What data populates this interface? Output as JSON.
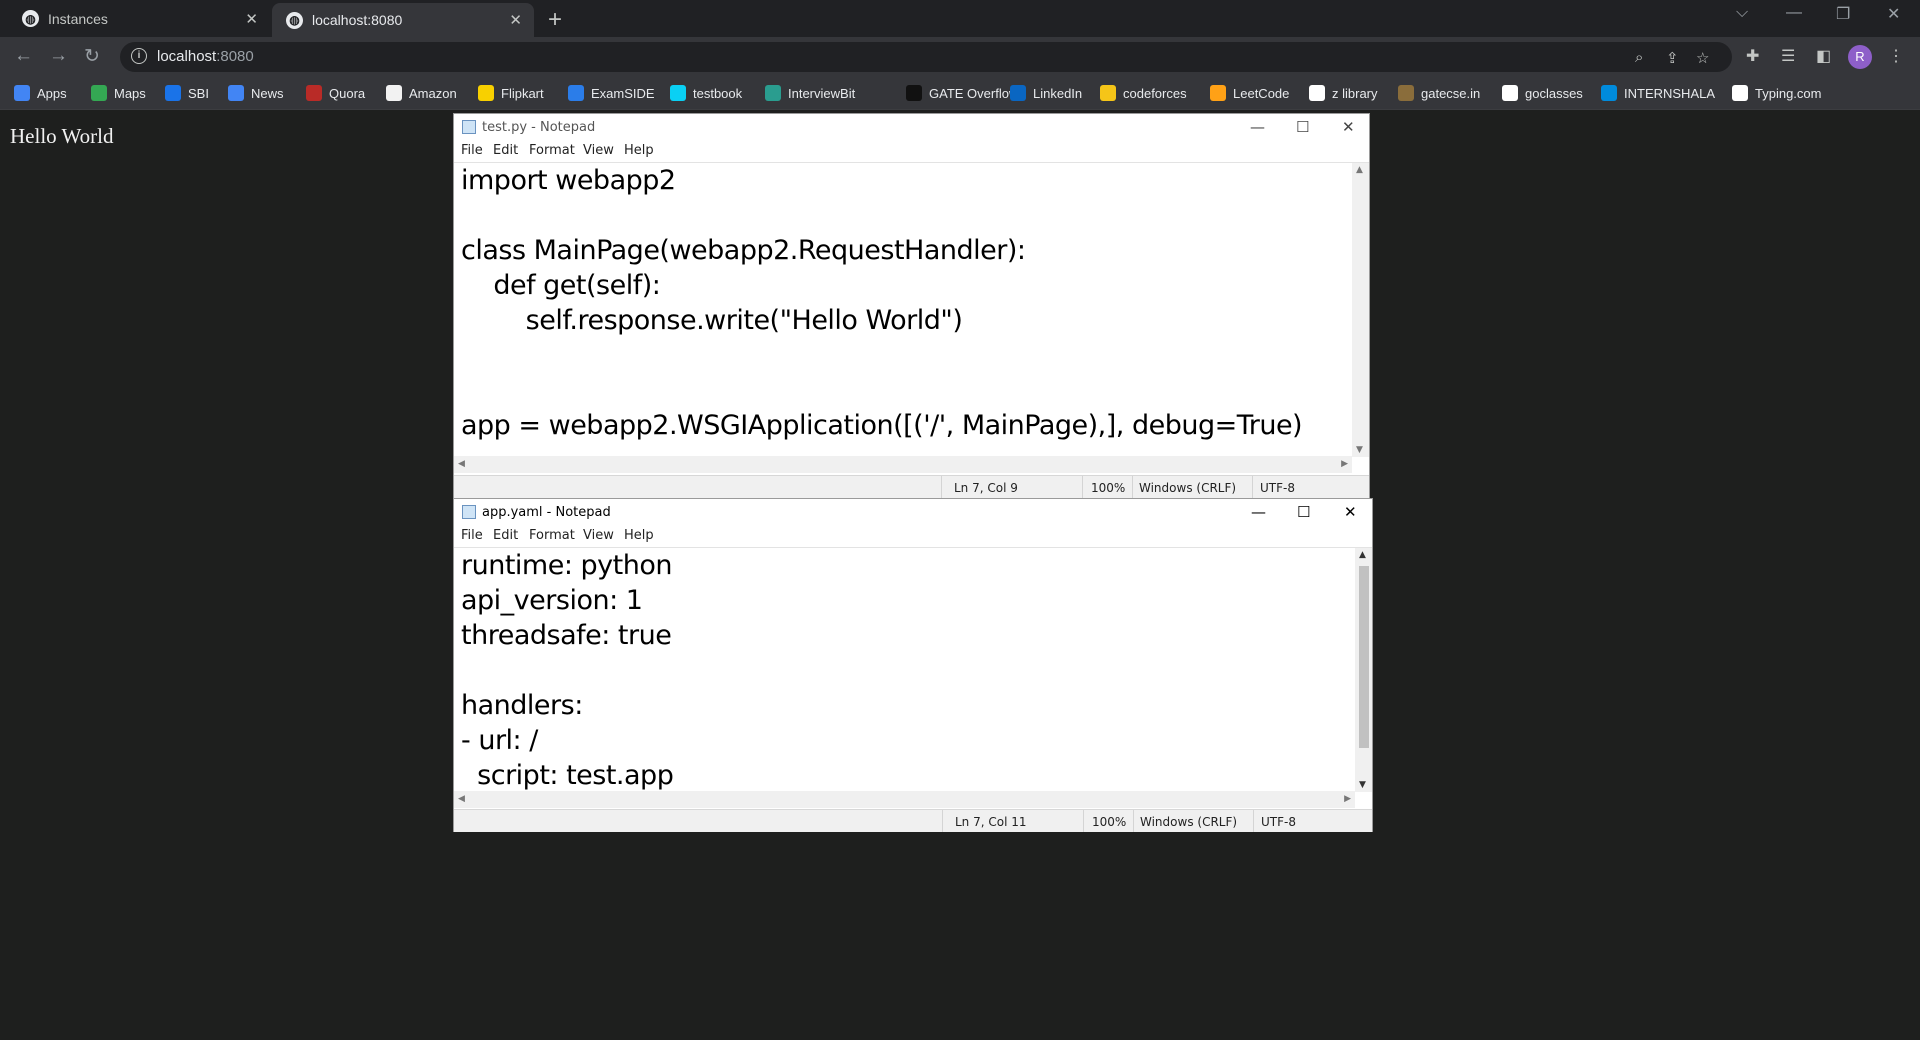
{
  "browser": {
    "tabs": [
      {
        "title": "Instances",
        "active": false
      },
      {
        "title": "localhost:8080",
        "active": true
      }
    ],
    "address": {
      "host": "localhost",
      "port": ":8080"
    },
    "profile_initial": "R",
    "bookmarks": [
      {
        "label": "Apps",
        "icon": "apps-grid-icon",
        "color": "#4285f4"
      },
      {
        "label": "Maps",
        "icon": "maps-icon",
        "color": "#34a853"
      },
      {
        "label": "SBI",
        "icon": "sbi-icon",
        "color": "#1a73e8"
      },
      {
        "label": "News",
        "icon": "google-news-icon",
        "color": "#4285f4"
      },
      {
        "label": "Quora",
        "icon": "quora-icon",
        "color": "#b92b27"
      },
      {
        "label": "Amazon",
        "icon": "amazon-icon",
        "color": "#f2f2f2"
      },
      {
        "label": "Flipkart",
        "icon": "flipkart-icon",
        "color": "#f8d000"
      },
      {
        "label": "ExamSIDE",
        "icon": "examside-icon",
        "color": "#2b7de9"
      },
      {
        "label": "testbook",
        "icon": "testbook-icon",
        "color": "#0ad0f4"
      },
      {
        "label": "InterviewBit",
        "icon": "interviewbit-icon",
        "color": "#2a9d8f"
      },
      {
        "label": "GATE Overflow",
        "icon": "gate-overflow-icon",
        "color": "#111111"
      },
      {
        "label": "LinkedIn",
        "icon": "linkedin-icon",
        "color": "#0a66c2"
      },
      {
        "label": "codeforces",
        "icon": "codeforces-icon",
        "color": "#f5c518"
      },
      {
        "label": "LeetCode",
        "icon": "leetcode-icon",
        "color": "#ffa116"
      },
      {
        "label": "z library",
        "icon": "z-library-icon",
        "color": "#ffffff"
      },
      {
        "label": "gatecse.in",
        "icon": "gatecse-icon",
        "color": "#8a6d3b"
      },
      {
        "label": "goclasses",
        "icon": "goclasses-icon",
        "color": "#ffffff"
      },
      {
        "label": "INTERNSHALA",
        "icon": "internshala-icon",
        "color": "#008bdc"
      },
      {
        "label": "Typing.com",
        "icon": "typing-icon",
        "color": "#ffffff"
      }
    ]
  },
  "page": {
    "body_text": "Hello World"
  },
  "notepad_test": {
    "title": "test.py - Notepad",
    "menu": [
      "File",
      "Edit",
      "Format",
      "View",
      "Help"
    ],
    "lines": [
      "import webapp2",
      "",
      "class MainPage(webapp2.RequestHandler):",
      "    def get(self):",
      "        self.response.write(\"Hello World\")",
      "",
      "",
      "app = webapp2.WSGIApplication([('/', MainPage),], debug=True)"
    ],
    "status": {
      "position": "Ln 7, Col 9",
      "zoom": "100%",
      "line_ending": "Windows (CRLF)",
      "encoding": "UTF-8"
    }
  },
  "notepad_yaml": {
    "title": "app.yaml - Notepad",
    "menu": [
      "File",
      "Edit",
      "Format",
      "View",
      "Help"
    ],
    "lines": [
      "runtime: python",
      "api_version: 1",
      "threadsafe: true",
      "",
      "handlers:",
      "- url: /",
      "  script: test.app"
    ],
    "status": {
      "position": "Ln 7, Col 11",
      "zoom": "100%",
      "line_ending": "Windows (CRLF)",
      "encoding": "UTF-8"
    }
  }
}
